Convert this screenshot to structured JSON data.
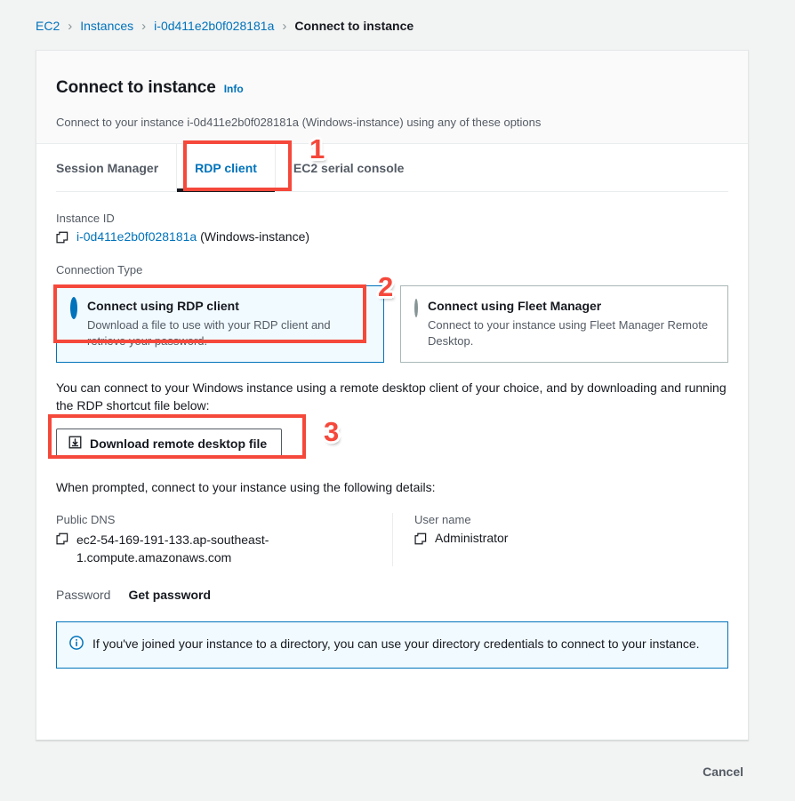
{
  "breadcrumb": {
    "items": [
      {
        "label": "EC2",
        "current": false
      },
      {
        "label": "Instances",
        "current": false
      },
      {
        "label": "i-0d411e2b0f028181a",
        "current": false
      },
      {
        "label": "Connect to instance",
        "current": true
      }
    ],
    "separator": "›"
  },
  "header": {
    "title": "Connect to instance",
    "info_label": "Info",
    "description": "Connect to your instance i-0d411e2b0f028181a (Windows-instance) using any of these options"
  },
  "tabs": [
    {
      "label": "Session Manager",
      "active": false
    },
    {
      "label": "RDP client",
      "active": true
    },
    {
      "label": "EC2 serial console",
      "active": false
    }
  ],
  "instance": {
    "label": "Instance ID",
    "id": "i-0d411e2b0f028181a",
    "name_suffix": " (Windows-instance)",
    "copy_icon": "copy-icon"
  },
  "connection_type": {
    "label": "Connection Type",
    "options": [
      {
        "title": "Connect using RDP client",
        "description": "Download a file to use with your RDP client and retrieve your password.",
        "selected": true
      },
      {
        "title": "Connect using Fleet Manager",
        "description": "Connect to your instance using Fleet Manager Remote Desktop.",
        "selected": false
      }
    ]
  },
  "instructions": {
    "rdp_paragraph": "You can connect to your Windows instance using a remote desktop client of your choice, and by downloading and running the RDP shortcut file below:",
    "download_button": "Download remote desktop file",
    "download_icon": "download-icon",
    "prompt_paragraph": "When prompted, connect to your instance using the following details:"
  },
  "details": {
    "public_dns_label": "Public DNS",
    "public_dns_value": "ec2-54-169-191-133.ap-southeast-1.compute.amazonaws.com",
    "user_name_label": "User name",
    "user_name_value": "Administrator"
  },
  "password": {
    "label": "Password",
    "button": "Get password"
  },
  "alert": {
    "icon": "info-circle-icon",
    "text": "If you've joined your instance to a directory, you can use your directory credentials to connect to your instance."
  },
  "footer": {
    "cancel": "Cancel"
  },
  "annotations": [
    {
      "number": "1"
    },
    {
      "number": "2"
    },
    {
      "number": "3"
    }
  ],
  "colors": {
    "accent_blue": "#0073bb",
    "annotation_red": "#f5483b",
    "text_dark": "#16191f",
    "text_muted": "#545b64",
    "page_bg": "#f2f3f3",
    "alert_bg": "#f1faff"
  }
}
